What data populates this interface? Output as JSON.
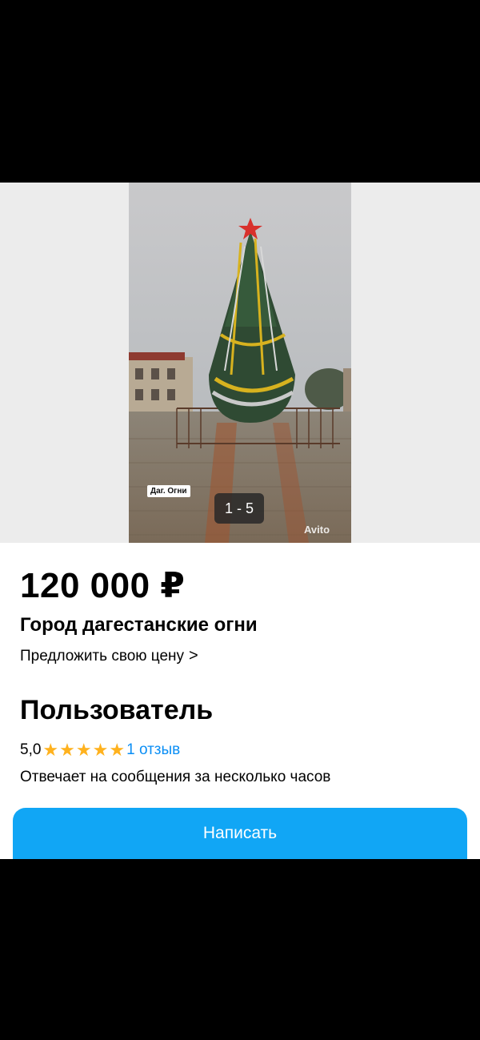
{
  "gallery": {
    "photo_label": "Даг. Огни",
    "counter": "1 - 5",
    "watermark": "Avito"
  },
  "listing": {
    "price": "120 000 ₽",
    "title": "Город дагестанские огни",
    "offer_price_label": "Предложить свою цену",
    "offer_chevron": ">"
  },
  "seller": {
    "name": "Пользователь",
    "rating": "5,0",
    "stars": 5,
    "star_icon": "star-icon",
    "reviews_link": "1 отзыв",
    "response_time": "Отвечает на сообщения за несколько часов"
  },
  "actions": {
    "write_button": "Написать"
  },
  "colors": {
    "accent": "#11a6f5",
    "link": "#0a8ef5",
    "star": "#ffb21e"
  }
}
